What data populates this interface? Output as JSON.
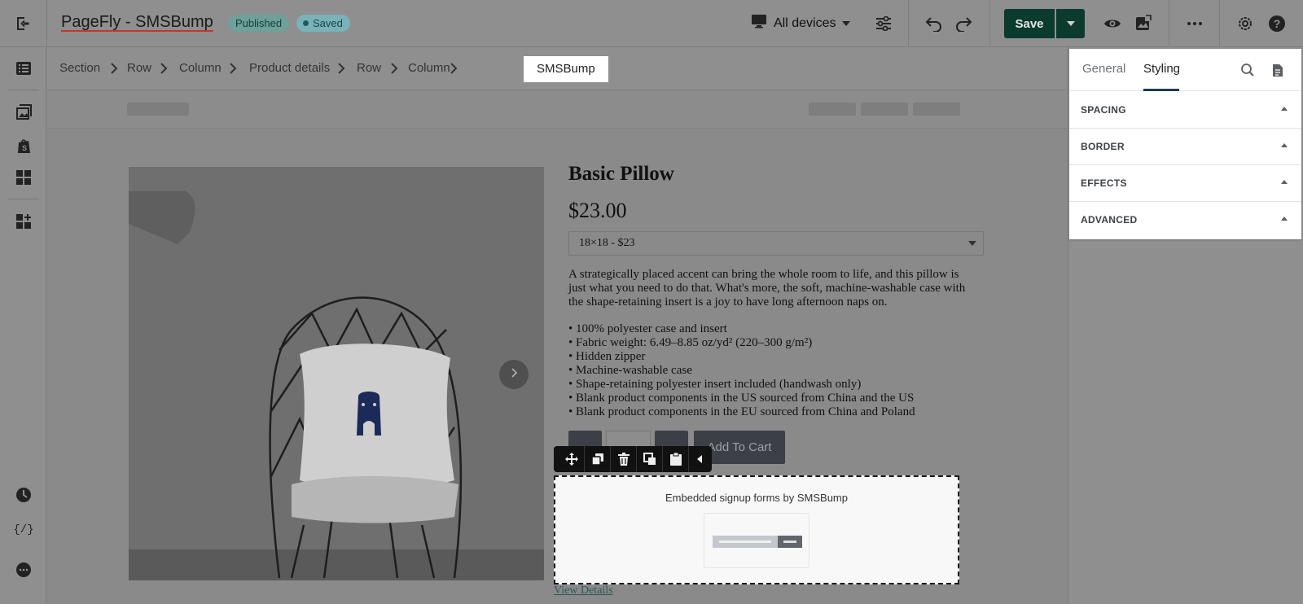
{
  "topbar": {
    "title": "PageFly - SMSBump",
    "status_published": "Published",
    "status_saved": "Saved",
    "device_selector": "All devices",
    "save_label": "Save",
    "icons": [
      "exit-icon",
      "desktop-icon",
      "chevron-down-icon",
      "sliders-icon",
      "undo-icon",
      "redo-icon",
      "eye-icon",
      "publish-icon",
      "more-icon",
      "settings-icon",
      "help-icon"
    ]
  },
  "sidebar": {
    "icons": [
      "page-outline-icon",
      "image-library-icon",
      "shopify-icon",
      "grid-icon",
      "add-section-icon",
      "history-icon",
      "code-icon",
      "chat-icon"
    ]
  },
  "breadcrumb": {
    "items": [
      "Section",
      "Row",
      "Column",
      "Product details",
      "Row",
      "Column"
    ],
    "active": "SMSBump"
  },
  "product": {
    "title": "Basic Pillow",
    "price": "$23.00",
    "variant": "18×18 - $23",
    "description": "A strategically placed accent can bring the whole room to life, and this pillow is just what you need to do that. What's more, the soft, machine-washable case with the shape-retaining insert is a joy to have long afternoon naps on.",
    "bullets": [
      "• 100% polyester case and insert",
      "• Fabric weight: 6.49–8.85 oz/yd² (220–300 g/m²)",
      "• Hidden zipper",
      "• Machine-washable case",
      "• Shape-retaining polyester insert included (handwash only)",
      "• Blank product components in the US sourced from China and the US",
      "• Blank product components in the EU sourced from China and Poland"
    ],
    "add_to_cart": "Add To Cart",
    "view_details": "View Details"
  },
  "element_toolbar": {
    "tools": [
      "move-icon",
      "duplicate-icon",
      "delete-icon",
      "copy-icon",
      "paste-icon",
      "collapse-icon"
    ]
  },
  "sms_widget": {
    "label": "Embedded signup forms by SMSBump"
  },
  "right_panel": {
    "tabs": [
      "General",
      "Styling"
    ],
    "active_tab": "Styling",
    "sections": [
      "SPACING",
      "BORDER",
      "EFFECTS",
      "ADVANCED"
    ]
  },
  "colors": {
    "save_button": "#0b3b2c",
    "overlay_gray": "#8a8a8a",
    "panel_bg": "#ffffff"
  }
}
